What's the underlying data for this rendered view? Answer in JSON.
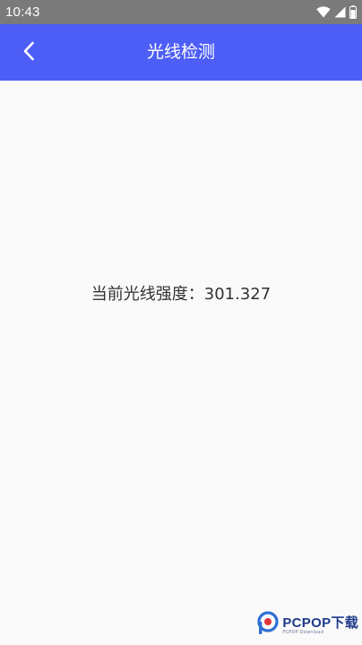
{
  "status_bar": {
    "time": "10:43",
    "icons": [
      "wifi-icon",
      "signal-icon",
      "battery-icon"
    ]
  },
  "app_bar": {
    "title": "光线检测",
    "back_icon": "chevron-left-icon",
    "color": "#4d5ef7"
  },
  "content": {
    "reading_label": "当前光线强度：",
    "reading_value": "301.327"
  },
  "watermark": {
    "brand": "PCPOP下载",
    "sub": "PCPOP Download",
    "logo_icon": "pcpop-logo-icon"
  }
}
